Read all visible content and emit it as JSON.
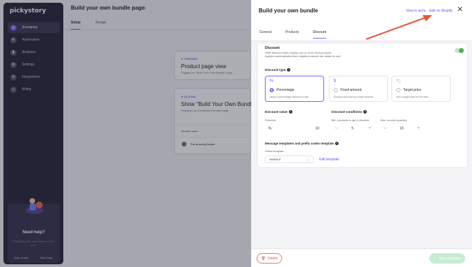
{
  "app": {
    "logo": "pickystory",
    "nav": [
      {
        "label": "Scenarios",
        "icon": "scenarios-icon",
        "active": true
      },
      {
        "label": "Automation",
        "icon": "automation-icon"
      },
      {
        "label": "Analytics",
        "icon": "analytics-icon"
      },
      {
        "label": "Settings",
        "icon": "settings-icon"
      },
      {
        "label": "Integrations",
        "icon": "integrations-icon"
      },
      {
        "label": "Billing",
        "icon": "billing-icon"
      }
    ],
    "help": {
      "title": "Need help?",
      "subtitle": "PickyStory live chat team is online 24/7",
      "help_center": "Help Center",
      "start_chat": "Start Chat"
    }
  },
  "background": {
    "page_title": "Build your own bundle page",
    "tabs": [
      "Setup",
      "Design"
    ],
    "trigger": {
      "eyebrow": "TRIGGER",
      "title": "Product page view",
      "subtitle": "Triggers on \"Build Your Own Bundle\" page"
    },
    "action": {
      "eyebrow": "ACTION",
      "title": "Show \"Build Your Own Bundle\"",
      "subtitle": "Displayed as a dedicated product page",
      "table_header": "Bundle name",
      "row": "The amazing Builder"
    }
  },
  "panel": {
    "title": "Build your own bundle",
    "view_in_store": "View in store",
    "edit_on_shopify": "Edit on Shopify",
    "tabs": [
      "General",
      "Products",
      "Discount"
    ],
    "active_tab": "Discount",
    "discount": {
      "title": "Discount",
      "sub1": "Offer discount when buying one or more deal products.",
      "sub2": "Applied automatically when eligible products are added to cart.",
      "enabled": true,
      "type_title": "Discount type",
      "types": [
        {
          "icon": "%",
          "label": "Percentage",
          "desc": "Apply a percentage discount to cart",
          "selected": true
        },
        {
          "icon": "$",
          "label": "Fixed amount",
          "desc": "Reduce cart price by a fixed amount",
          "selected": false
        },
        {
          "icon": "tag",
          "label": "Target price",
          "desc": "Set a target price for the deal",
          "selected": false
        }
      ],
      "value_title": "Discount value",
      "percents_label": "Percents",
      "percent_symbol": "%",
      "percent_value": "10",
      "conditions_title": "Discount conditions",
      "min_label": "Min. products to get a discount",
      "min_value": "5",
      "max_label": "Max. product quantity",
      "max_value": "10",
      "minus": "−",
      "plus": "+",
      "templates_title": "Message templates and prefix codes template",
      "select_label": "Select template",
      "select_value": "BUNDLE",
      "edit_template": "Edit template"
    },
    "footer": {
      "delete": "Delete",
      "save": "Save changes"
    }
  },
  "colors": {
    "accent": "#7b61ff",
    "danger": "#e05656",
    "success": "#4caf50",
    "annotation_arrow": "#e8553a"
  }
}
